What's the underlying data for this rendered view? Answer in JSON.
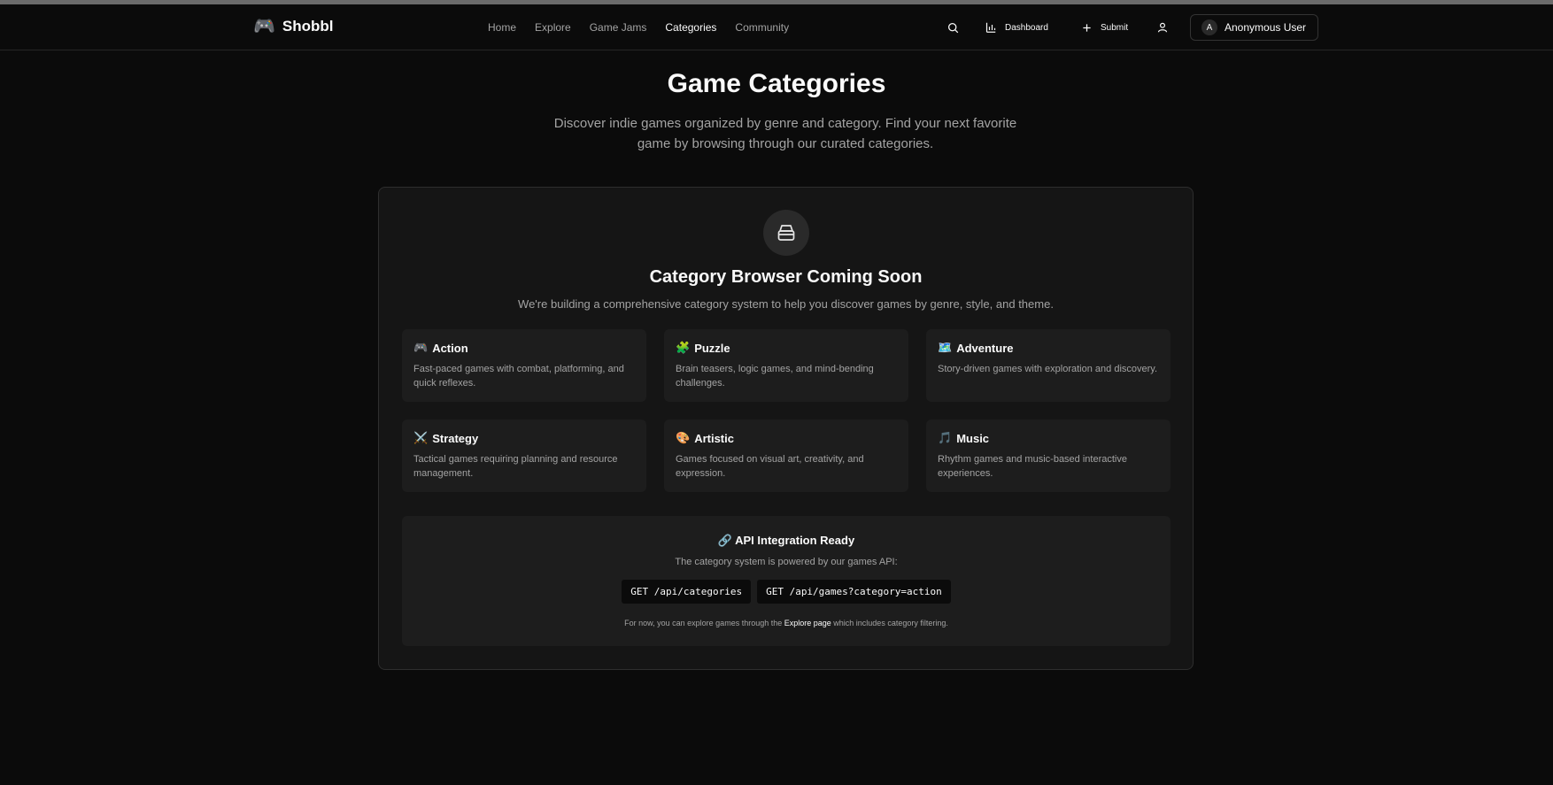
{
  "brand": {
    "emoji": "🎮",
    "name": "Shobbl"
  },
  "nav": {
    "items": [
      {
        "label": "Home"
      },
      {
        "label": "Explore"
      },
      {
        "label": "Game Jams"
      },
      {
        "label": "Categories"
      },
      {
        "label": "Community"
      }
    ],
    "active": "Categories"
  },
  "toolbar": {
    "search_icon": "search-icon",
    "dashboard_label": "Dashboard",
    "submit_label": "Submit",
    "profile_icon": "user-icon"
  },
  "user": {
    "initial": "A",
    "name": "Anonymous User"
  },
  "hero": {
    "title": "Game Categories",
    "subtitle": "Discover indie games organized by genre and category. Find your next favorite game by browsing through our curated categories."
  },
  "card": {
    "icon": "box-icon",
    "title": "Category Browser Coming Soon",
    "subtitle": "We're building a comprehensive category system to help you discover games by genre, style, and theme.",
    "categories": [
      {
        "emoji": "🎮",
        "name": "Action",
        "description": "Fast-paced games with combat, platforming, and quick reflexes."
      },
      {
        "emoji": "🧩",
        "name": "Puzzle",
        "description": "Brain teasers, logic games, and mind-bending challenges."
      },
      {
        "emoji": "🗺️",
        "name": "Adventure",
        "description": "Story-driven games with exploration and discovery."
      },
      {
        "emoji": "⚔️",
        "name": "Strategy",
        "description": "Tactical games requiring planning and resource management."
      },
      {
        "emoji": "🎨",
        "name": "Artistic",
        "description": "Games focused on visual art, creativity, and expression."
      },
      {
        "emoji": "🎵",
        "name": "Music",
        "description": "Rhythm games and music-based interactive experiences."
      }
    ]
  },
  "api": {
    "title": "🔗 API Integration Ready",
    "subtitle": "The category system is powered by our games API:",
    "endpoints": [
      "GET /api/categories",
      "GET /api/games?category=action"
    ],
    "note_before": "For now, you can explore games through the ",
    "note_link": "Explore page",
    "note_after": " which includes category filtering."
  }
}
